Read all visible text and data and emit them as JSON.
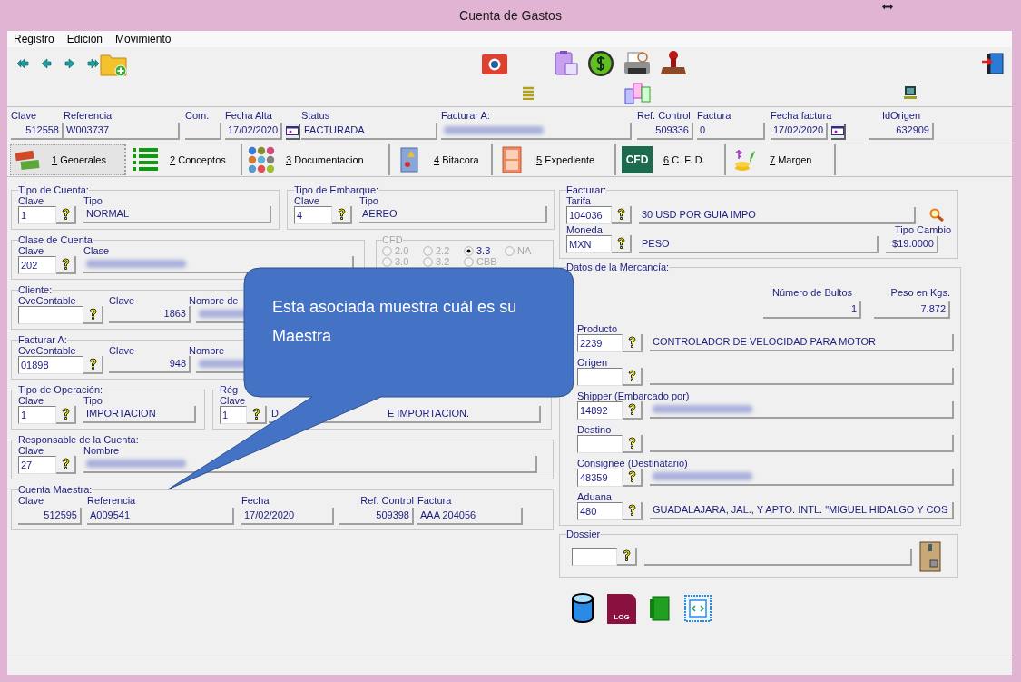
{
  "window": {
    "title": "Cuenta de Gastos"
  },
  "menu": [
    "Registro",
    "Edición",
    "Movimiento"
  ],
  "header": [
    {
      "label": "Clave",
      "value": "512558"
    },
    {
      "label": "Referencia",
      "value": "W003737"
    },
    {
      "label": "Com."
    },
    {
      "label": "Fecha Alta",
      "value": "17/02/2020",
      "calendar": true
    },
    {
      "label": "Status",
      "value": "FACTURADA"
    },
    {
      "label": "Facturar A:",
      "redacted": true
    },
    {
      "label": "Ref. Control",
      "value": "509336"
    },
    {
      "label": "Factura",
      "value": "0"
    },
    {
      "label": "Fecha factura",
      "value": "17/02/2020",
      "calendar": true
    },
    {
      "label": "IdOrigen",
      "value": "632909"
    }
  ],
  "tabs": [
    {
      "number": "1",
      "label": "Generales",
      "selected": true
    },
    {
      "number": "2",
      "label": "Conceptos",
      "selected": false
    },
    {
      "number": "3",
      "label": "Documentacion",
      "selected": false
    },
    {
      "number": "4",
      "label": "Bitacora",
      "selected": false
    },
    {
      "number": "5",
      "label": "Expediente",
      "selected": false
    },
    {
      "number": "6",
      "label": "C. F. D.",
      "selected": false,
      "icon_text": "CFD"
    },
    {
      "number": "7",
      "label": "Margen",
      "selected": false
    }
  ],
  "tipo_cuenta": {
    "title": "Tipo de Cuenta:",
    "labels": [
      "Clave",
      "Tipo"
    ],
    "clave": "1",
    "value": "NORMAL"
  },
  "tipo_embarque": {
    "title": "Tipo de Embarque:",
    "labels": [
      "Clave",
      "Tipo"
    ],
    "clave": "4",
    "value": "AEREO"
  },
  "clase_cuenta": {
    "title": "Clase de Cuenta",
    "labels": [
      "Clave",
      "Clase"
    ],
    "clave": "202",
    "redacted": true
  },
  "cfd": {
    "title": "CFD",
    "options": [
      {
        "label": "2.0",
        "selected": false
      },
      {
        "label": "2.2",
        "selected": false
      },
      {
        "label": "3.3",
        "selected": true
      },
      {
        "label": "NA",
        "selected": false
      },
      {
        "label": "3.0",
        "selected": false
      },
      {
        "label": "3.2",
        "selected": false
      },
      {
        "label": "CBB",
        "selected": false
      }
    ]
  },
  "cliente": {
    "title": "Cliente:",
    "labels": [
      "CveContable",
      "Clave",
      "Nombre de"
    ],
    "clave": "1863",
    "redacted": true
  },
  "facturar_a": {
    "title": "Facturar A:",
    "labels": [
      "CveContable",
      "Clave",
      "Nombre"
    ],
    "cve": "01898",
    "clave": "948",
    "redacted": true
  },
  "tipo_operacion": {
    "title": "Tipo de Operación:",
    "labels": [
      "Clave",
      "Tipo"
    ],
    "clave": "1",
    "value": "IMPORTACION"
  },
  "regimen": {
    "title": "Rég",
    "labels": [
      "Clave"
    ],
    "clave": "1",
    "value_parts": [
      "D",
      "E IMPORTACION."
    ]
  },
  "responsable": {
    "title": "Responsable de la Cuenta:",
    "labels": [
      "Clave",
      "Nombre"
    ],
    "clave": "27",
    "redacted": true
  },
  "cuenta_maestra": {
    "title": "Cuenta Maestra:",
    "fields": [
      {
        "label": "Clave",
        "value": "512595"
      },
      {
        "label": "Referencia",
        "value": "A009541"
      },
      {
        "label": "Fecha",
        "value": "17/02/2020"
      },
      {
        "label": "Ref. Control",
        "value": "509398"
      },
      {
        "label": "Factura",
        "value": "AAA 204056"
      }
    ]
  },
  "facturar": {
    "title": "Facturar:",
    "rows": [
      {
        "label": "Tarifa",
        "clave": "104036",
        "value": "30 USD POR GUIA IMPO"
      },
      {
        "label": "Moneda",
        "clave": "MXN",
        "value": "PESO"
      }
    ],
    "tipo_cambio": {
      "label": "Tipo Cambio",
      "value": "$19.0000"
    }
  },
  "mercancia": {
    "title": "Datos de la Mercancía:",
    "bultos": {
      "label": "Número de Bultos",
      "value": "1"
    },
    "peso": {
      "label": "Peso en Kgs.",
      "value": "7.872"
    },
    "rows": [
      {
        "label": "Producto",
        "clave": "2239",
        "value": "CONTROLADOR DE VELOCIDAD PARA MOTOR"
      },
      {
        "label": "Origen"
      },
      {
        "label": "Shipper (Embarcado por)",
        "clave": "14892",
        "redacted": true
      },
      {
        "label": "Destino"
      },
      {
        "label": "Consignee (Destinatario)",
        "clave": "48359",
        "redacted": true
      },
      {
        "label": "Aduana",
        "clave": "480",
        "value": "GUADALAJARA, JAL., Y APTO. INTL. \"MIGUEL HIDALGO Y COS"
      }
    ]
  },
  "dossier": {
    "title": "Dossier"
  },
  "bottom_icons": {
    "log_label": "LOG"
  },
  "callout": {
    "text": "Esta asociada muestra cuál es su Maestra"
  }
}
